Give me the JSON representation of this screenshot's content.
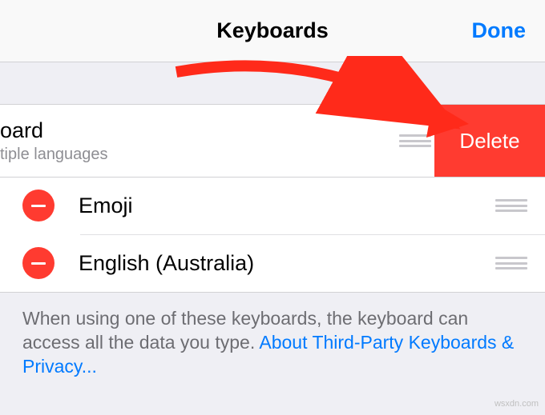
{
  "nav": {
    "title": "Keyboards",
    "done_label": "Done"
  },
  "swipedRow": {
    "title_fragment": "oard",
    "subtitle_fragment": "tiple languages",
    "delete_label": "Delete"
  },
  "rows": [
    {
      "label": "Emoji"
    },
    {
      "label": "English (Australia)"
    }
  ],
  "footer": {
    "text": "When using one of these keyboards, the keyboard can access all the data you type. ",
    "link": "About Third-Party Keyboards & Privacy..."
  },
  "watermark": "wsxdn.com"
}
